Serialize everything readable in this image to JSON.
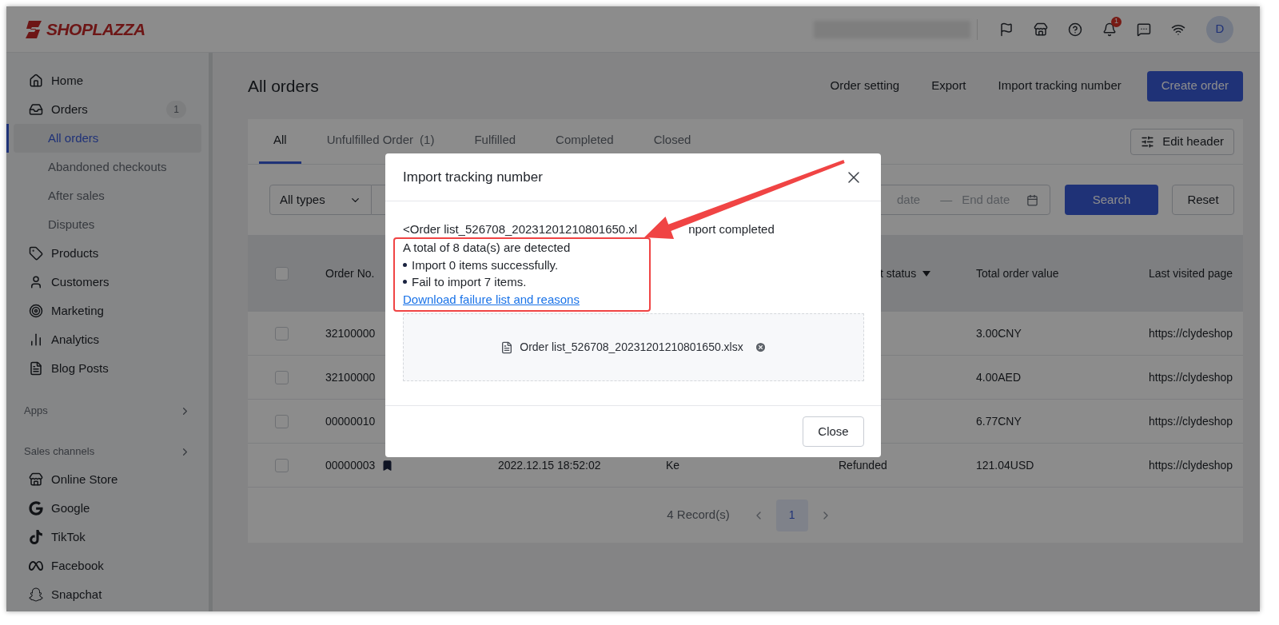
{
  "brand": {
    "name": "SHOPLAZZA"
  },
  "top_bar": {
    "notification_count": "1",
    "avatar": "D"
  },
  "sidebar": {
    "items": [
      {
        "label": "Home",
        "selected": false
      },
      {
        "label": "Orders",
        "badge": "1",
        "selected": false,
        "children": [
          {
            "label": "All orders",
            "selected": true
          },
          {
            "label": "Abandoned checkouts",
            "selected": false
          },
          {
            "label": "After sales",
            "selected": false
          },
          {
            "label": "Disputes",
            "selected": false
          }
        ]
      },
      {
        "label": "Products",
        "selected": false
      },
      {
        "label": "Customers",
        "selected": false
      },
      {
        "label": "Marketing",
        "selected": false
      },
      {
        "label": "Analytics",
        "selected": false
      },
      {
        "label": "Blog Posts",
        "selected": false
      }
    ],
    "sections": [
      {
        "label": "Apps"
      },
      {
        "label": "Sales channels",
        "items": [
          {
            "label": "Online Store",
            "selected": false
          },
          {
            "label": "Google",
            "selected": false
          },
          {
            "label": "TikTok",
            "selected": false
          },
          {
            "label": "Facebook",
            "selected": false
          },
          {
            "label": "Snapchat",
            "selected": false
          }
        ]
      }
    ]
  },
  "page": {
    "title": "All orders",
    "actions": [
      "Order setting",
      "Export",
      "Import tracking number"
    ],
    "primary_action": "Create order"
  },
  "tabs": [
    {
      "label": "All",
      "selected": true
    },
    {
      "label": "Unfulfilled Order",
      "count": "(1)",
      "selected": false
    },
    {
      "label": "Fulfilled",
      "selected": false
    },
    {
      "label": "Completed",
      "selected": false
    },
    {
      "label": "Closed",
      "selected": false
    }
  ],
  "edit_header_button": "Edit header",
  "filters": {
    "type_select": "All types",
    "date_start_visible": "date",
    "date_separator": "—",
    "date_end_placeholder": "End date",
    "search_button": "Search",
    "reset_button": "Reset"
  },
  "table": {
    "all_checked": false,
    "header": {
      "column_2": "Order No.",
      "column_5": "t status",
      "column_6": "Total order value",
      "column_7": "Last visited page"
    },
    "rows": [
      {
        "checked": false,
        "bookmarked": false,
        "column_2": "32100000",
        "column_6": "3.00CNY",
        "column_7": "https://clydeshop"
      },
      {
        "checked": false,
        "bookmarked": false,
        "column_2": "32100000",
        "column_6": "4.00AED",
        "column_7": "https://clydeshop"
      },
      {
        "checked": false,
        "bookmarked": false,
        "column_2": "00000010",
        "column_6": "6.77CNY",
        "column_7": "https://clydeshop"
      },
      {
        "checked": false,
        "bookmarked": true,
        "column_2": "00000003",
        "column_3": "2022.12.15 18:52:02",
        "column_4": "Ke",
        "column_5": "Refunded",
        "column_6": "121.04USD",
        "column_7": "https://clydeshop"
      }
    ]
  },
  "pagination": {
    "summary": "4 Record(s)",
    "pages": [
      {
        "label": "1",
        "selected": true
      }
    ]
  },
  "modal": {
    "title": "Import tracking number",
    "file_line_start": "<Order list_526708_20231201210801650.xl",
    "file_line_end": "nport completed",
    "summary": "A total of 8 data(s) are detected",
    "results": [
      "Import 0 items successfully.",
      "Fail to import 7 items."
    ],
    "link": "Download failure list and reasons",
    "file_name": "Order list_526708_20231201210801650.xlsx",
    "close_button": "Close"
  }
}
